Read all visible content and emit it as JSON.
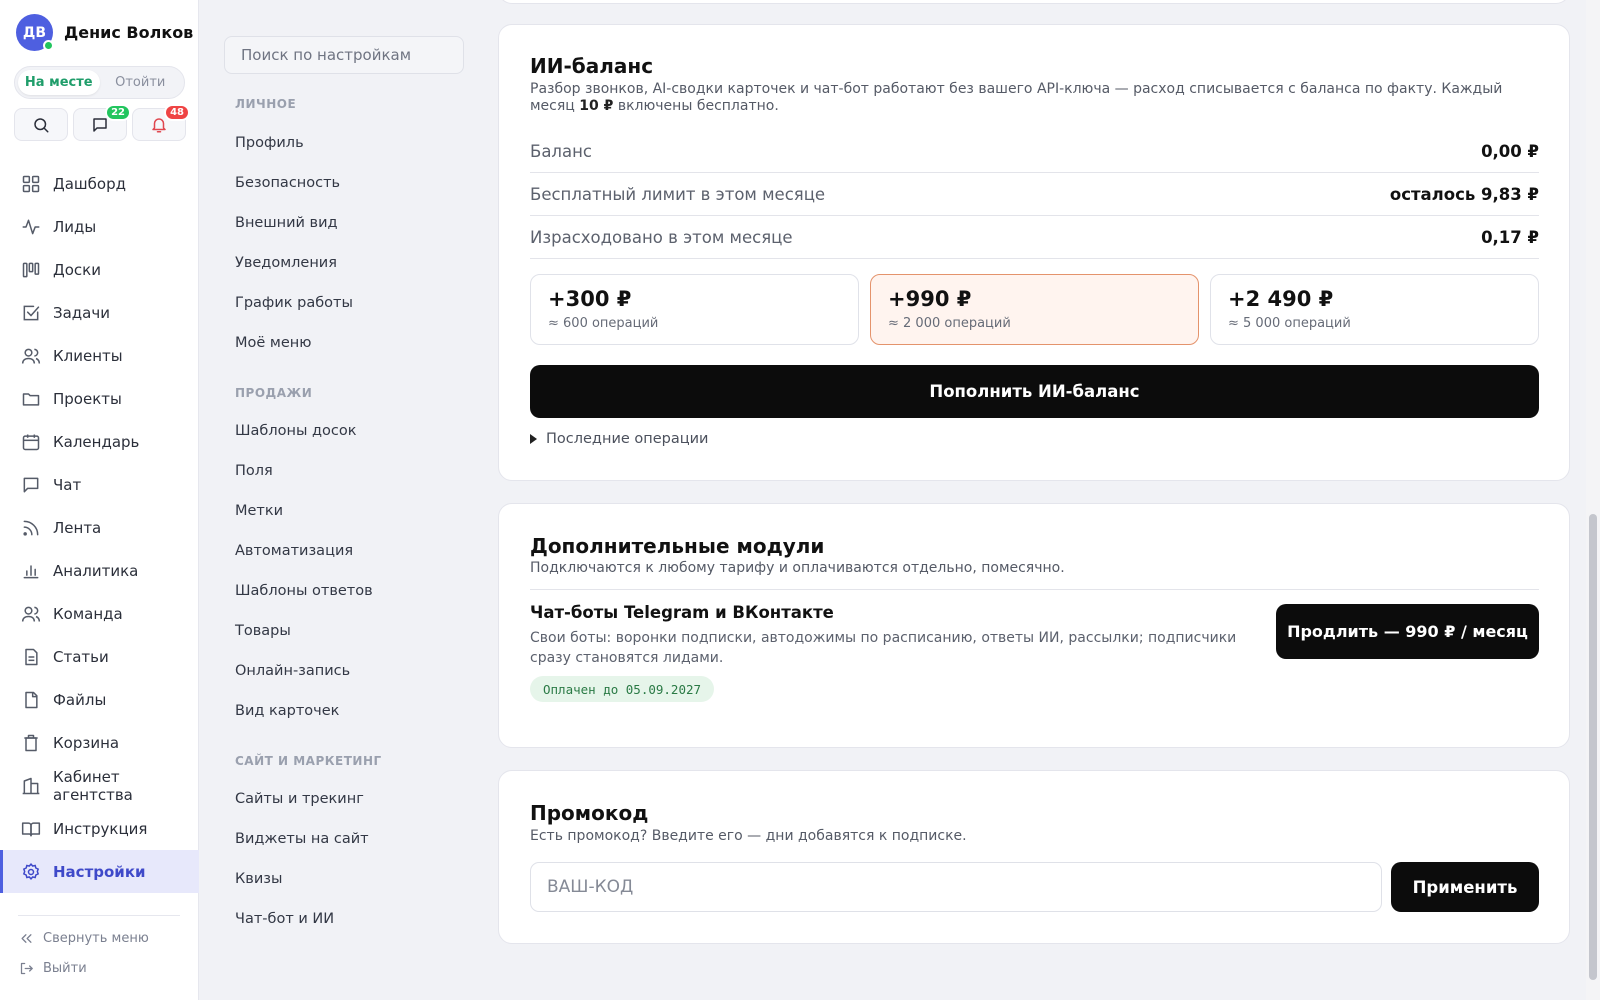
{
  "user": {
    "initials": "ДВ",
    "name": "Денис Волков"
  },
  "status": {
    "options": [
      "На месте",
      "Отойти"
    ],
    "selected": "На месте"
  },
  "quick_actions": {
    "messages_count": "22",
    "notifications_count": "48"
  },
  "nav": {
    "items": [
      {
        "label": "Дашборд",
        "icon": "dashboard-icon"
      },
      {
        "label": "Лиды",
        "icon": "activity-icon"
      },
      {
        "label": "Доски",
        "icon": "kanban-icon"
      },
      {
        "label": "Задачи",
        "icon": "checkbox-icon"
      },
      {
        "label": "Клиенты",
        "icon": "users-icon"
      },
      {
        "label": "Проекты",
        "icon": "folder-icon"
      },
      {
        "label": "Календарь",
        "icon": "calendar-icon"
      },
      {
        "label": "Чат",
        "icon": "chat-icon"
      },
      {
        "label": "Лента",
        "icon": "rss-icon"
      },
      {
        "label": "Аналитика",
        "icon": "bar-chart-icon"
      },
      {
        "label": "Команда",
        "icon": "team-icon"
      },
      {
        "label": "Статьи",
        "icon": "document-icon"
      },
      {
        "label": "Файлы",
        "icon": "file-icon"
      },
      {
        "label": "Корзина",
        "icon": "trash-icon"
      },
      {
        "label": "Кабинет агентства",
        "icon": "building-icon"
      },
      {
        "label": "Инструкция",
        "icon": "book-icon"
      },
      {
        "label": "Настройки",
        "icon": "gear-icon"
      }
    ],
    "active": "Настройки",
    "collapse_label": "Свернуть меню",
    "logout_label": "Выйти"
  },
  "settings_nav": {
    "search_placeholder": "Поиск по настройкам",
    "groups": [
      {
        "title": "ЛИЧНОЕ",
        "items": [
          "Профиль",
          "Безопасность",
          "Внешний вид",
          "Уведомления",
          "График работы",
          "Моё меню"
        ]
      },
      {
        "title": "ПРОДАЖИ",
        "items": [
          "Шаблоны досок",
          "Поля",
          "Метки",
          "Автоматизация",
          "Шаблоны ответов",
          "Товары",
          "Онлайн-запись",
          "Вид карточек"
        ]
      },
      {
        "title": "САЙТ И МАРКЕТИНГ",
        "items": [
          "Сайты и трекинг",
          "Виджеты на сайт",
          "Квизы",
          "Чат-бот и ИИ"
        ]
      }
    ]
  },
  "ai_balance": {
    "title": "ИИ-баланс",
    "desc_line1": "Разбор звонков, AI-сводки карточек и чат-бот работают без вашего API-ключа — расход списывается с баланса по факту. Каждый",
    "desc_pre": "месяц",
    "desc_amount": "10 ₽",
    "desc_post": "включены бесплатно.",
    "rows": [
      {
        "label": "Баланс",
        "value": "0,00 ₽"
      },
      {
        "label": "Бесплатный лимит в этом месяце",
        "value": "осталось 9,83 ₽"
      },
      {
        "label": "Израсходовано в этом месяце",
        "value": "0,17 ₽"
      }
    ],
    "packages": [
      {
        "amount": "+300 ₽",
        "ops": "≈ 600 операций"
      },
      {
        "amount": "+990 ₽",
        "ops": "≈ 2 000 операций"
      },
      {
        "amount": "+2 490 ₽",
        "ops": "≈ 5 000 операций"
      }
    ],
    "selected_package": "+990 ₽",
    "topup_label": "Пополнить ИИ-баланс",
    "recent_label": "Последние операции"
  },
  "modules": {
    "title": "Дополнительные модули",
    "subtitle": "Подключаются к любому тарифу и оплачиваются отдельно, помесячно.",
    "item": {
      "title": "Чат-боты Telegram и ВКонтакте",
      "desc": "Свои боты: воронки подписки, автодожимы по расписанию, ответы ИИ, рассылки; подписчики сразу становятся лидами.",
      "badge": "Оплачен до 05.09.2027",
      "button": "Продлить — 990 ₽ / месяц"
    }
  },
  "promo": {
    "title": "Промокод",
    "subtitle": "Есть промокод? Введите его — дни добавятся к подписке.",
    "placeholder": "ВАШ-КОД",
    "value": "",
    "button": "Применить"
  },
  "colors": {
    "accent": "#4e5fe0",
    "online": "#22c55e",
    "messages_badge": "#22c55e",
    "notifications_badge": "#ef4444",
    "selected_package_border": "#e4936c",
    "paid_badge_bg": "#e6f5ea"
  }
}
